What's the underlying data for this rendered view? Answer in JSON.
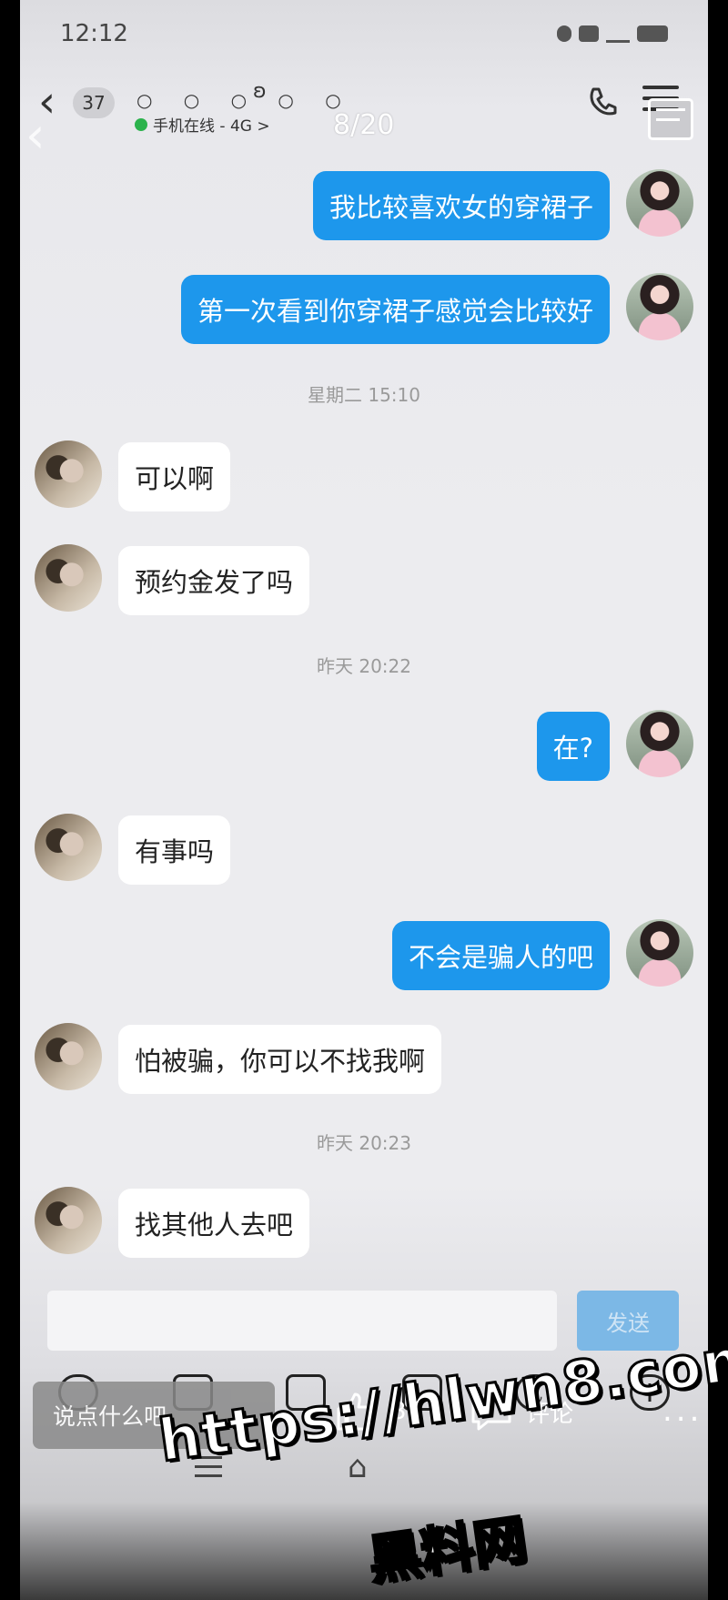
{
  "status_bar": {
    "time": "12:12"
  },
  "header": {
    "badge_count": "37",
    "name_masked": "○ ○ ○ ○ ○",
    "online_status": "手机在线 - 4G >",
    "image_counter": "8/20"
  },
  "messages": [
    {
      "side": "me",
      "text": "我比较喜欢女的穿裙子"
    },
    {
      "side": "me",
      "text": "第一次看到你穿裙子感觉会比较好"
    },
    {
      "side": "time",
      "text": "星期二 15:10"
    },
    {
      "side": "her",
      "text": "可以啊"
    },
    {
      "side": "her",
      "text": "预约金发了吗"
    },
    {
      "side": "time",
      "text": "昨天 20:22"
    },
    {
      "side": "me",
      "text": "在?"
    },
    {
      "side": "her",
      "text": "有事吗"
    },
    {
      "side": "me",
      "text": "不会是骗人的吧"
    },
    {
      "side": "her",
      "text": "怕被骗，你可以不找我啊"
    },
    {
      "side": "time",
      "text": "昨天 20:23"
    },
    {
      "side": "her",
      "text": "找其他人去吧"
    }
  ],
  "composer": {
    "send_label": "发送"
  },
  "overlay": {
    "comment_placeholder": "说点什么吧",
    "like_count": "3",
    "comment_label": "评论",
    "more": "..."
  },
  "watermark": {
    "url": "https://hlwn8.com",
    "cn": "黑料网"
  },
  "colors": {
    "my_bubble": "#1d97ec",
    "her_bubble": "#ffffff",
    "background": "#ececef"
  }
}
